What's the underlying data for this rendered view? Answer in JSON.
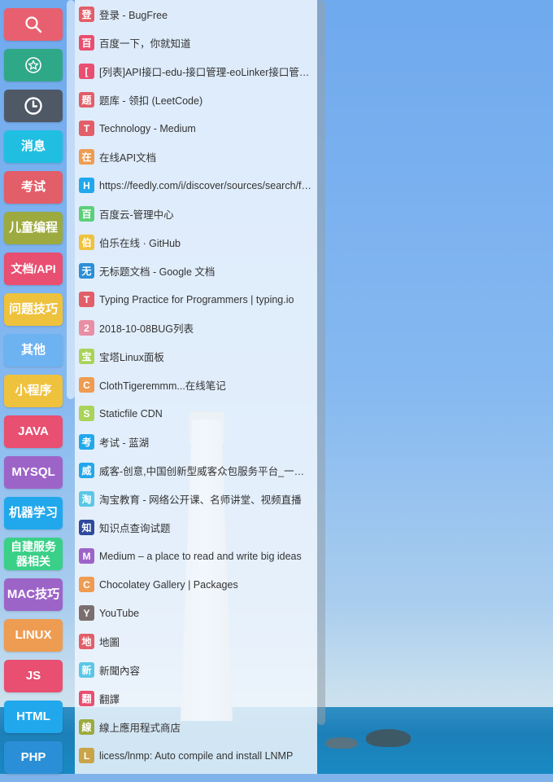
{
  "categories": [
    {
      "icon": "search-icon",
      "color": "#e8606f"
    },
    {
      "icon": "star-badge-icon",
      "color": "#2fa887"
    },
    {
      "icon": "clock-icon",
      "color": "#4f5965"
    },
    {
      "label": "消息",
      "color": "#20bfe2"
    },
    {
      "label": "考试",
      "color": "#e25e69"
    },
    {
      "label": "儿童编程",
      "color": "#9caa3f"
    },
    {
      "label": "文档/API",
      "color": "#e84f71"
    },
    {
      "label": "问题技巧",
      "color": "#efc23d"
    },
    {
      "label": "其他",
      "color": "#6db3f1"
    },
    {
      "label": "小程序",
      "color": "#efc23d"
    },
    {
      "label": "JAVA",
      "color": "#e84f71"
    },
    {
      "label": "MYSQL",
      "color": "#9d64c8"
    },
    {
      "label": "机器学习",
      "color": "#21a8ec"
    },
    {
      "label": "自建服务器相关",
      "color": "#3ad087"
    },
    {
      "label": "MAC技巧",
      "color": "#9d64c8"
    },
    {
      "label": "LINUX",
      "color": "#ee9c52"
    },
    {
      "label": "JS",
      "color": "#e84f71"
    },
    {
      "label": "HTML",
      "color": "#21a8ec"
    },
    {
      "label": "PHP",
      "color": "#2a8fd6"
    }
  ],
  "bookmarks": [
    {
      "badge": "登",
      "color": "#e25e69",
      "title": "登录 - BugFree"
    },
    {
      "badge": "百",
      "color": "#e84f71",
      "title": "百度一下，你就知道"
    },
    {
      "badge": "[",
      "color": "#e84f71",
      "title": "[列表]API接口-edu-接口管理-eoLinker接口管理平台"
    },
    {
      "badge": "题",
      "color": "#e25e69",
      "title": "题库 - 领扣 (LeetCode)"
    },
    {
      "badge": "T",
      "color": "#e25e69",
      "title": "Technology - Medium"
    },
    {
      "badge": "在",
      "color": "#ee9c52",
      "title": "在线API文档"
    },
    {
      "badge": "H",
      "color": "#21a8ec",
      "title": "https://feedly.com/i/discover/sources/search/feed"
    },
    {
      "badge": "百",
      "color": "#5ccf7a",
      "title": "百度云-管理中心"
    },
    {
      "badge": "伯",
      "color": "#efc23d",
      "title": "伯乐在线 · GitHub"
    },
    {
      "badge": "无",
      "color": "#2a8fd6",
      "title": "无标题文档 - Google 文档"
    },
    {
      "badge": "T",
      "color": "#e25e69",
      "title": "Typing Practice for Programmers | typing.io"
    },
    {
      "badge": "2",
      "color": "#e88fa6",
      "title": "2018-10-08BUG列表"
    },
    {
      "badge": "宝",
      "color": "#a9d35a",
      "title": "宝塔Linux面板"
    },
    {
      "badge": "C",
      "color": "#ee9c52",
      "title": "ClothTigeremmm...在线笔记"
    },
    {
      "badge": "S",
      "color": "#a9d35a",
      "title": "Staticfile CDN"
    },
    {
      "badge": "考",
      "color": "#21a8ec",
      "title": "考试 - 蓝湖"
    },
    {
      "badge": "威",
      "color": "#21a8ec",
      "title": "威客-创意,中国创新型威客众包服务平台_一品威客网"
    },
    {
      "badge": "淘",
      "color": "#5bc7e6",
      "title": "淘宝教育 - 网络公开课、名师讲堂、视频直播"
    },
    {
      "badge": "知",
      "color": "#2e4a9c",
      "title": "知识点查询试题"
    },
    {
      "badge": "M",
      "color": "#9d64c8",
      "title": "Medium – a place to read and write big ideas"
    },
    {
      "badge": "C",
      "color": "#ee9c52",
      "title": "Chocolatey Gallery | Packages"
    },
    {
      "badge": "Y",
      "color": "#7a6e6e",
      "title": "YouTube"
    },
    {
      "badge": "地",
      "color": "#e25e69",
      "title": "地圖"
    },
    {
      "badge": "新",
      "color": "#5bc7e6",
      "title": "新聞內容"
    },
    {
      "badge": "翻",
      "color": "#e84f71",
      "title": "翻譯"
    },
    {
      "badge": "線",
      "color": "#9caa3f",
      "title": "線上應用程式商店"
    },
    {
      "badge": "L",
      "color": "#c9a449",
      "title": "licess/lnmp: Auto compile and install LNMP"
    }
  ]
}
